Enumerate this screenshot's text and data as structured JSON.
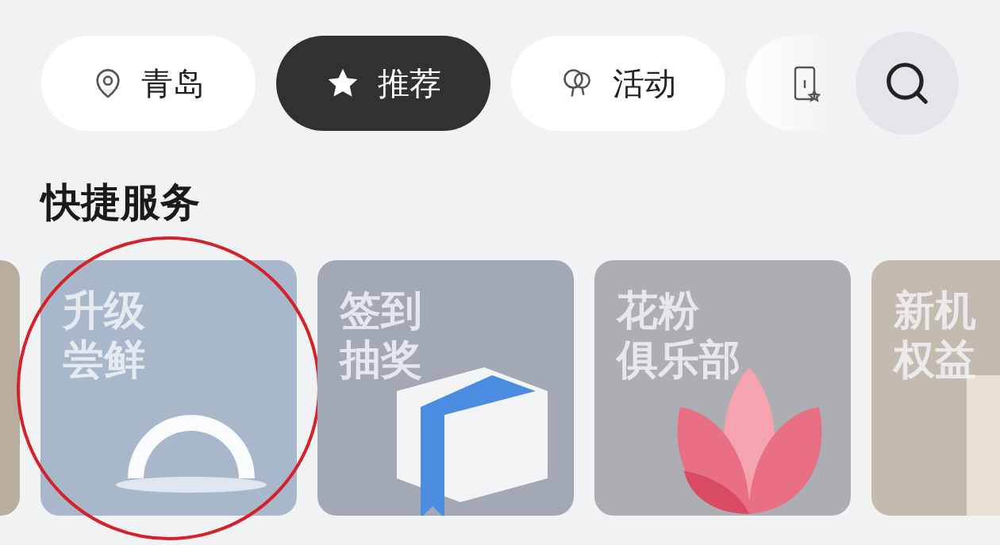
{
  "tabs": [
    {
      "kind": "location",
      "label": "青岛",
      "selected": false
    },
    {
      "kind": "star",
      "label": "推荐",
      "selected": true
    },
    {
      "kind": "balloon",
      "label": "活动",
      "selected": false
    },
    {
      "kind": "card",
      "selected": false
    }
  ],
  "section": {
    "title": "快捷服务"
  },
  "tiles": [
    {
      "kind": "photo",
      "circled": false
    },
    {
      "kind": "ring",
      "lines": [
        "升级",
        "尝鲜"
      ],
      "circled": true
    },
    {
      "kind": "gift",
      "lines": [
        "签到",
        "抽奖"
      ],
      "circled": false
    },
    {
      "kind": "lotus",
      "lines": [
        "花粉",
        "俱乐部"
      ],
      "circled": false
    },
    {
      "kind": "box",
      "lines": [
        "新机",
        "权益"
      ],
      "circled": false
    }
  ]
}
